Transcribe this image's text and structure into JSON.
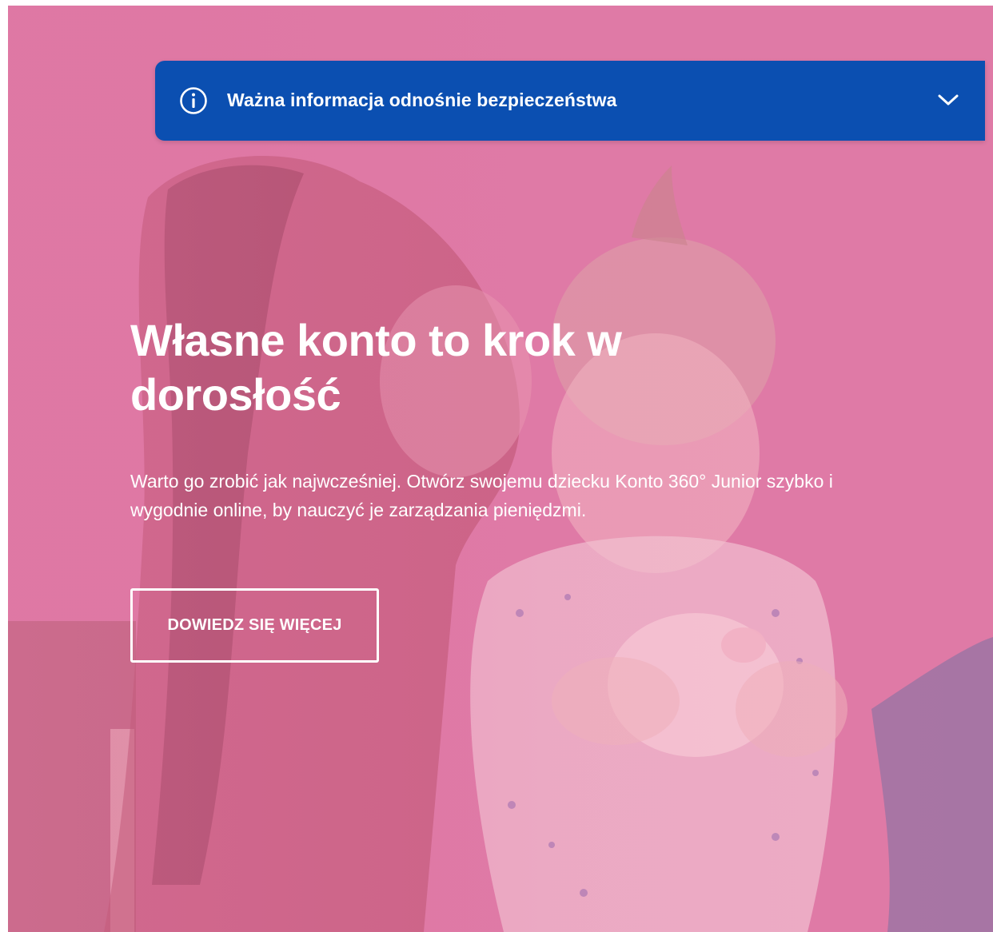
{
  "banner": {
    "text": "Ważna informacja odnośnie bezpieczeństwa",
    "icon": "info-icon",
    "toggle_icon": "chevron-down-icon",
    "background_color": "#0b4fb1"
  },
  "hero": {
    "headline": "Własne konto to krok w dorosłość",
    "description": "Warto go zrobić jak najwcześniej. Otwórz swojemu dziecku Konto 360° Junior szybko i wygodnie online, by nauczyć je zarządzania pieniędzmi.",
    "cta_label": "DOWIEDZ SIĘ WIĘCEJ",
    "overlay_color": "#dd78a3"
  }
}
